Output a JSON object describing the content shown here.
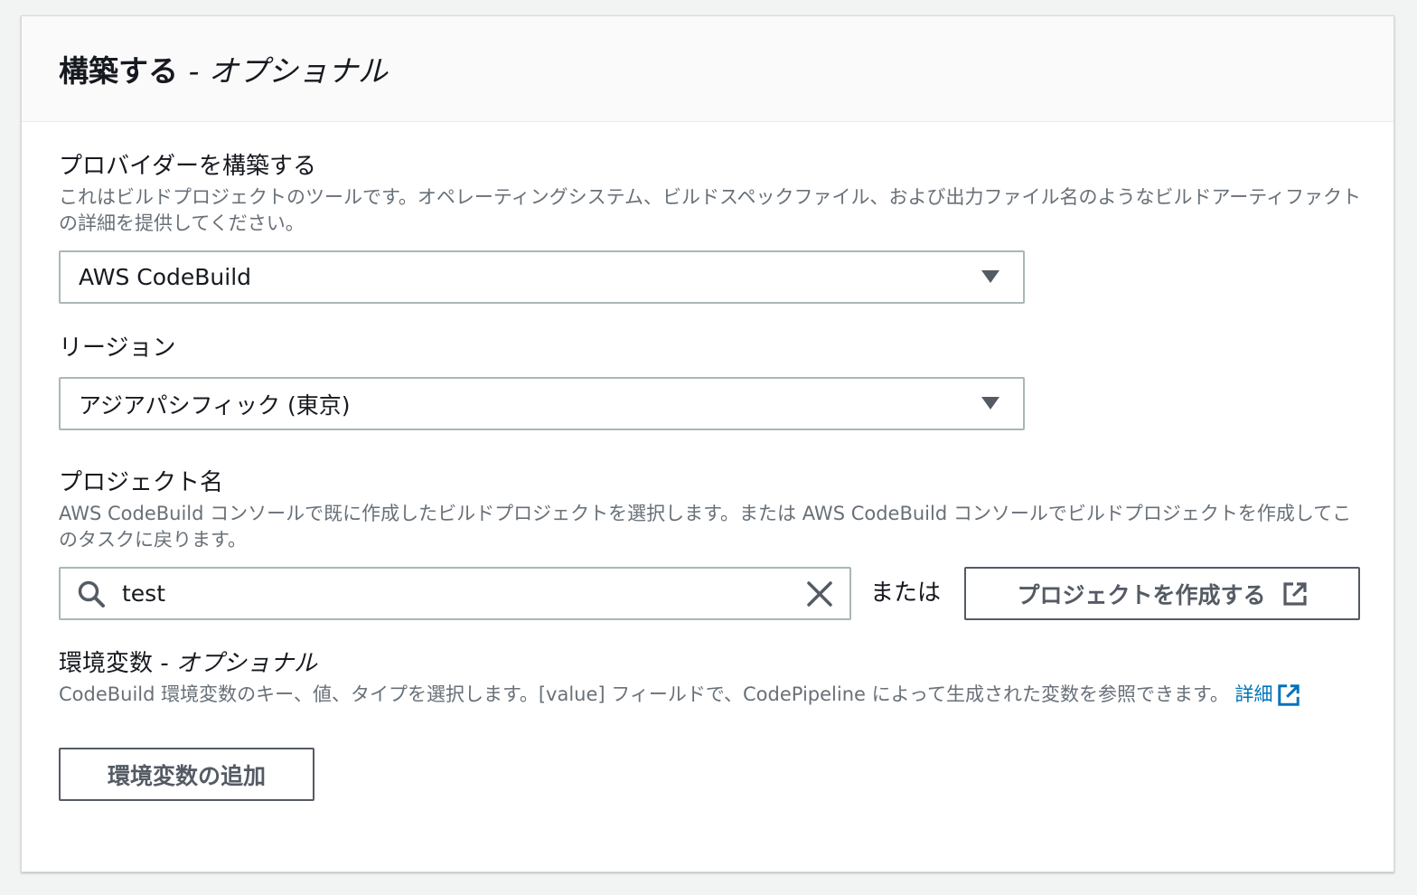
{
  "panel": {
    "title": "構築する",
    "title_suffix": "- オプショナル"
  },
  "provider": {
    "label": "プロバイダーを構築する",
    "description": "これはビルドプロジェクトのツールです。オペレーティングシステム、ビルドスペックファイル、および出力ファイル名のようなビルドアーティファクトの詳細を提供してください。",
    "selected": "AWS CodeBuild"
  },
  "region": {
    "label": "リージョン",
    "selected": "アジアパシフィック (東京)"
  },
  "project": {
    "label": "プロジェクト名",
    "description": "AWS CodeBuild コンソールで既に作成したビルドプロジェクトを選択します。または AWS CodeBuild コンソールでビルドプロジェクトを作成してこのタスクに戻ります。",
    "search_value": "test",
    "or_text": "または",
    "create_button": "プロジェクトを作成する"
  },
  "env": {
    "label": "環境変数",
    "label_suffix": "- オプショナル",
    "description": "CodeBuild 環境変数のキー、値、タイプを選択します。[value] フィールドで、CodePipeline によって生成された変数を参照できます。",
    "link_text": "詳細",
    "add_button": "環境変数の追加"
  },
  "icons": {
    "caret": "caret-down-icon",
    "search": "search-icon",
    "clear": "close-icon",
    "external": "external-link-icon"
  },
  "colors": {
    "link": "#0073bb",
    "border": "#aab7b8",
    "button_border": "#545b64"
  }
}
